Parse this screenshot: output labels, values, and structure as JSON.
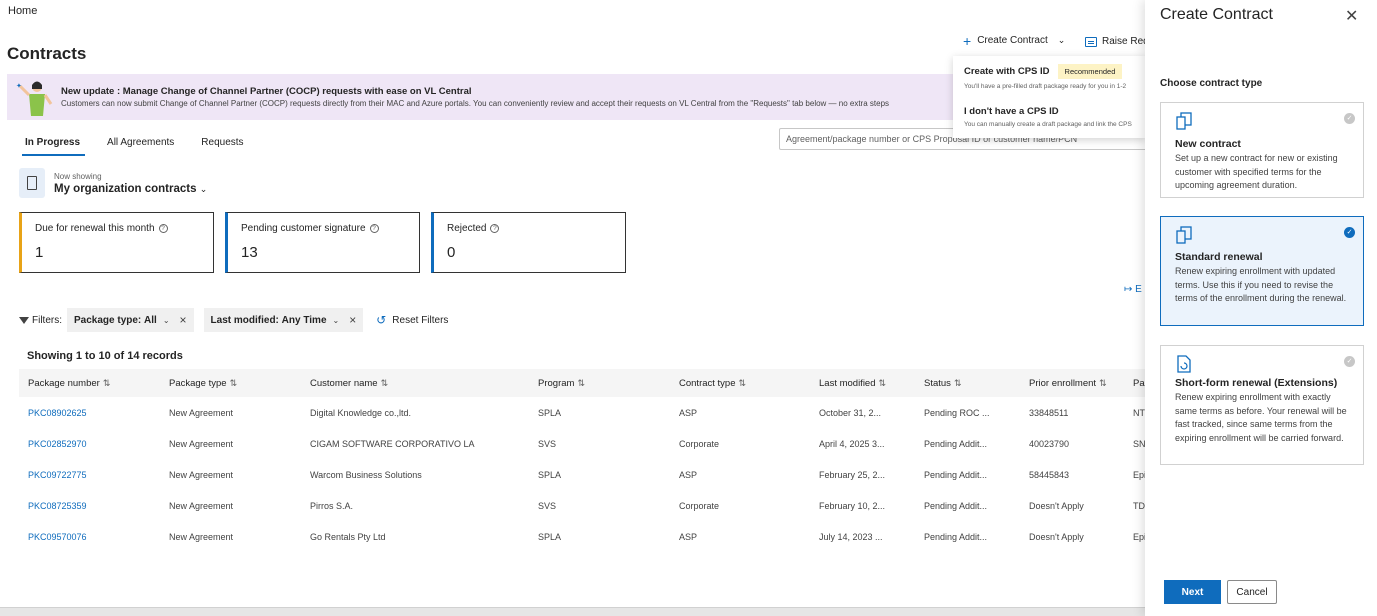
{
  "breadcrumb": "Home",
  "page_title": "Contracts",
  "top_actions": {
    "create_contract": "Create Contract",
    "raise_request": "Raise Requ"
  },
  "banner": {
    "title": "New update : Manage Change of Channel Partner (COCP) requests with ease on VL Central",
    "text": "Customers can now submit Change of Channel Partner (COCP) requests directly from their MAC and Azure portals. You can conveniently review and accept their requests on VL Central from the \"Requests\" tab below — no extra steps"
  },
  "dropdown": {
    "items": [
      {
        "title": "Create with CPS ID",
        "badge": "Recommended",
        "desc": "You'll have a pre-filled draft package ready for you in 1-2"
      },
      {
        "title": "I don't have a CPS ID",
        "desc": "You can manually create a draft package and link the CPS"
      }
    ]
  },
  "tabs": [
    "In Progress",
    "All Agreements",
    "Requests"
  ],
  "search": {
    "placeholder": "Agreement/package number or CPS Proposal ID or customer name/PCN"
  },
  "showing": {
    "label": "Now showing",
    "value": "My organization contracts"
  },
  "cards": [
    {
      "title": "Due for renewal this month",
      "value": "1",
      "accent": "#e8a317"
    },
    {
      "title": "Pending customer signature",
      "value": "13",
      "accent": "#0f6cbd"
    },
    {
      "title": "Rejected",
      "value": "0",
      "accent": "#0f6cbd"
    }
  ],
  "export_label": "E",
  "filters": {
    "label": "Filters:",
    "chips": [
      {
        "key": "Package type:",
        "value": "All"
      },
      {
        "key": "Last modified:",
        "value": "Any Time"
      }
    ],
    "reset": "Reset Filters"
  },
  "records": "Showing 1 to 10 of 14 records",
  "table": {
    "headers": [
      "Package number",
      "Package type",
      "Customer name",
      "Program",
      "Contract type",
      "Last modified",
      "Status",
      "Prior enrollment",
      "Par"
    ],
    "rows": [
      [
        "PKC08902625",
        "New Agreement",
        "Digital Knowledge co.,ltd.",
        "SPLA",
        "ASP",
        "October 31, 2...",
        "Pending ROC ...",
        "33848511",
        "NT"
      ],
      [
        "PKC02852970",
        "New Agreement",
        "CIGAM SOFTWARE CORPORATIVO LA",
        "SVS",
        "Corporate",
        "April 4, 2025 3...",
        "Pending Addit...",
        "40023790",
        "SN"
      ],
      [
        "PKC09722775",
        "New Agreement",
        "Warcom Business Solutions",
        "SPLA",
        "ASP",
        "February 25, 2...",
        "Pending Addit...",
        "58445843",
        "Epi"
      ],
      [
        "PKC08725359",
        "New Agreement",
        "Pirros S.A.",
        "SVS",
        "Corporate",
        "February 10, 2...",
        "Pending Addit...",
        "Doesn't Apply",
        "TD"
      ],
      [
        "PKC09570076",
        "New Agreement",
        "Go Rentals Pty Ltd",
        "SPLA",
        "ASP",
        "July 14, 2023 ...",
        "Pending Addit...",
        "Doesn't Apply",
        "Epi"
      ]
    ]
  },
  "panel": {
    "title": "Create Contract",
    "choose_label": "Choose contract type",
    "options": [
      {
        "title": "New contract",
        "desc": "Set up a new contract for new or existing customer with specified terms for the upcoming agreement duration.",
        "selected": false
      },
      {
        "title": "Standard renewal",
        "desc": "Renew expiring enrollment with updated terms. Use this if you need to revise the terms of the enrollment during the renewal.",
        "selected": true
      },
      {
        "title": "Short-form renewal (Extensions)",
        "desc": "Renew expiring enrollment with exactly same terms as before. Your renewal will be fast tracked, since same terms from the expiring enrollment will be carried forward.",
        "selected": false
      }
    ],
    "next": "Next",
    "cancel": "Cancel"
  }
}
